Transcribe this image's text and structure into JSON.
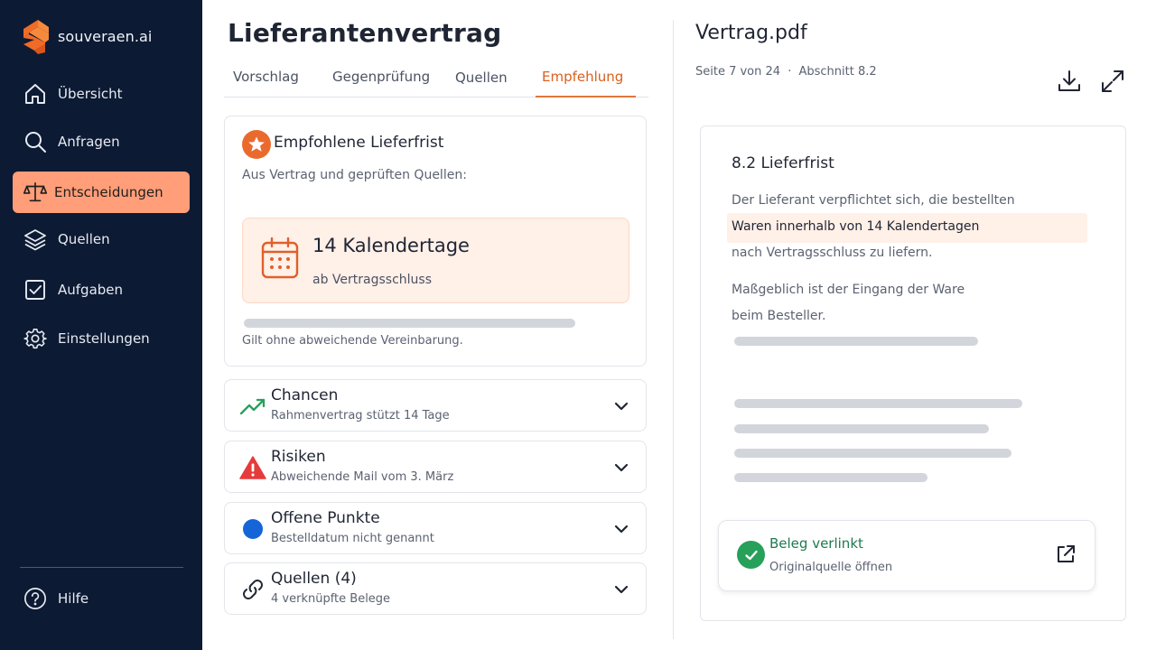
{
  "app": {
    "name": "souveraen.ai"
  },
  "colors": {
    "sidebar": "#0d1a33",
    "accent": "#ff9e78",
    "brand_orange": "#ea6a2e",
    "success": "#27a05a",
    "danger": "#e53b3b",
    "info": "#1565d8"
  },
  "sidebar": {
    "items": [
      {
        "label": "Übersicht",
        "icon": "home-icon"
      },
      {
        "label": "Anfragen",
        "icon": "search-icon"
      },
      {
        "label": "Entscheidungen",
        "icon": "scale-icon",
        "active": true
      },
      {
        "label": "Quellen",
        "icon": "layers-icon"
      },
      {
        "label": "Aufgaben",
        "icon": "checkbox-icon"
      },
      {
        "label": "Einstellungen",
        "icon": "gear-icon"
      }
    ],
    "help": {
      "label": "Hilfe",
      "icon": "help-icon"
    }
  },
  "main": {
    "title": "Lieferantenvertrag",
    "tabs": [
      {
        "label": "Vorschlag"
      },
      {
        "label": "Gegenprüfung"
      },
      {
        "label": "Quellen"
      },
      {
        "label": "Empfehlung",
        "active": true
      }
    ],
    "recommendation": {
      "title": "Empfohlene Lieferfrist",
      "subtitle": "Aus Vertrag und geprüften Quellen:",
      "value": "14 Kalendertage",
      "note": "ab Vertragsschluss",
      "footer": "Gilt ohne abweichende Vereinbarung."
    },
    "sections": [
      {
        "title": "Chancen",
        "subtitle": "Rahmenvertrag stützt 14 Tage",
        "icon": "trend-up-icon"
      },
      {
        "title": "Risiken",
        "subtitle": "Abweichende Mail vom 3. März",
        "icon": "warning-icon"
      },
      {
        "title": "Offene Punkte",
        "subtitle": "Bestelldatum nicht genannt",
        "icon": "dot-icon"
      },
      {
        "title": "Quellen (4)",
        "subtitle": "4 verknüpfte Belege",
        "icon": "link-icon"
      }
    ]
  },
  "document": {
    "title": "Vertrag.pdf",
    "page": "Seite 7 von 24",
    "separator": "·",
    "section": "Abschnitt 8.2",
    "heading": "8.2 Lieferfrist",
    "lines": [
      "Der Lieferant verpflichtet sich, die bestellten",
      "Waren innerhalb von 14 Kalendertagen",
      "nach Vertragsschluss zu liefern.",
      "Maßgeblich ist der Eingang der Ware",
      "beim Besteller."
    ],
    "proof": {
      "title": "Beleg verlinkt",
      "subtitle": "Originalquelle öffnen"
    }
  }
}
